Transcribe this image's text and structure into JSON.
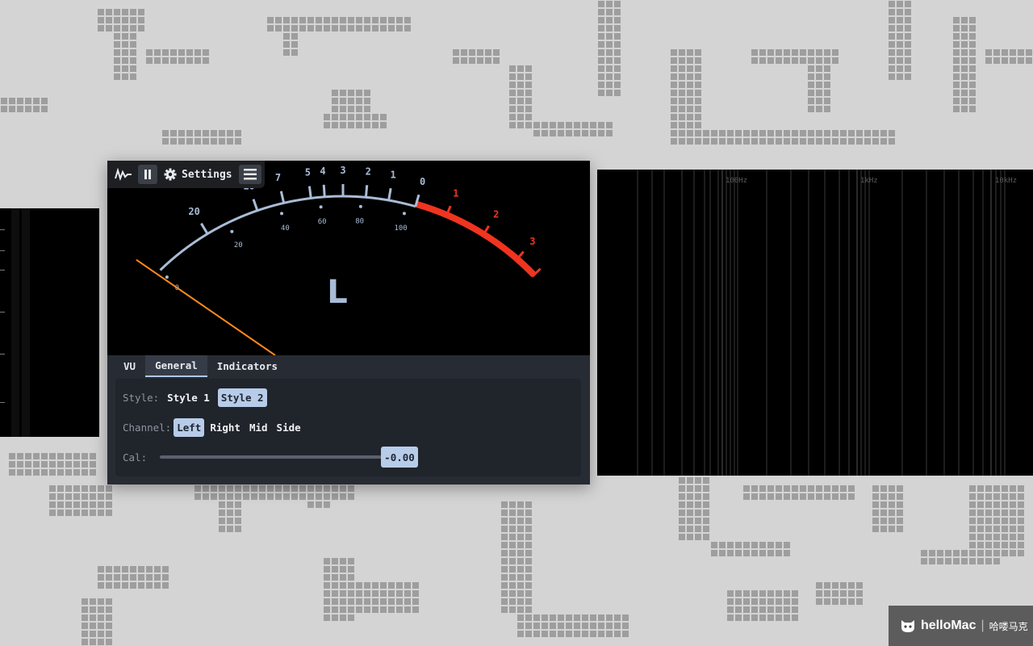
{
  "toolbar": {
    "logo_icon": "waveform-logo-icon",
    "pause_icon": "pause-icon",
    "settings_icon": "gear-icon",
    "settings_label": "Settings",
    "menu_icon": "hamburger-menu-icon"
  },
  "meter": {
    "channel_letter": "L",
    "vu_scale_labels": [
      "20",
      "10",
      "7",
      "5",
      "4",
      "3",
      "2",
      "1",
      "0",
      "1",
      "2",
      "3"
    ],
    "percent_scale_labels": [
      "0",
      "20",
      "40",
      "60",
      "80",
      "100"
    ],
    "colors": {
      "scale": "#a9bcd6",
      "red_zone": "#f0341f",
      "needle": "#ff8a1e"
    }
  },
  "tabs": [
    {
      "label": "VU",
      "active": false
    },
    {
      "label": "General",
      "active": true
    },
    {
      "label": "Indicators",
      "active": false
    }
  ],
  "general": {
    "style_label": "Style:",
    "style_options": [
      "Style 1",
      "Style 2"
    ],
    "style_selected": "Style 2",
    "channel_label": "Channel:",
    "channel_options": [
      "Left",
      "Right",
      "Mid",
      "Side"
    ],
    "channel_selected": "Left",
    "cal_label": "Cal:",
    "cal_value": "-0.00"
  },
  "spectrum": {
    "freq_labels": [
      "100Hz",
      "1kHz",
      "10kHz"
    ]
  },
  "watermark": {
    "brand": "helloMac",
    "separator": "|",
    "cn_text": "哈喽马克",
    "icon": "cat-face-icon"
  }
}
